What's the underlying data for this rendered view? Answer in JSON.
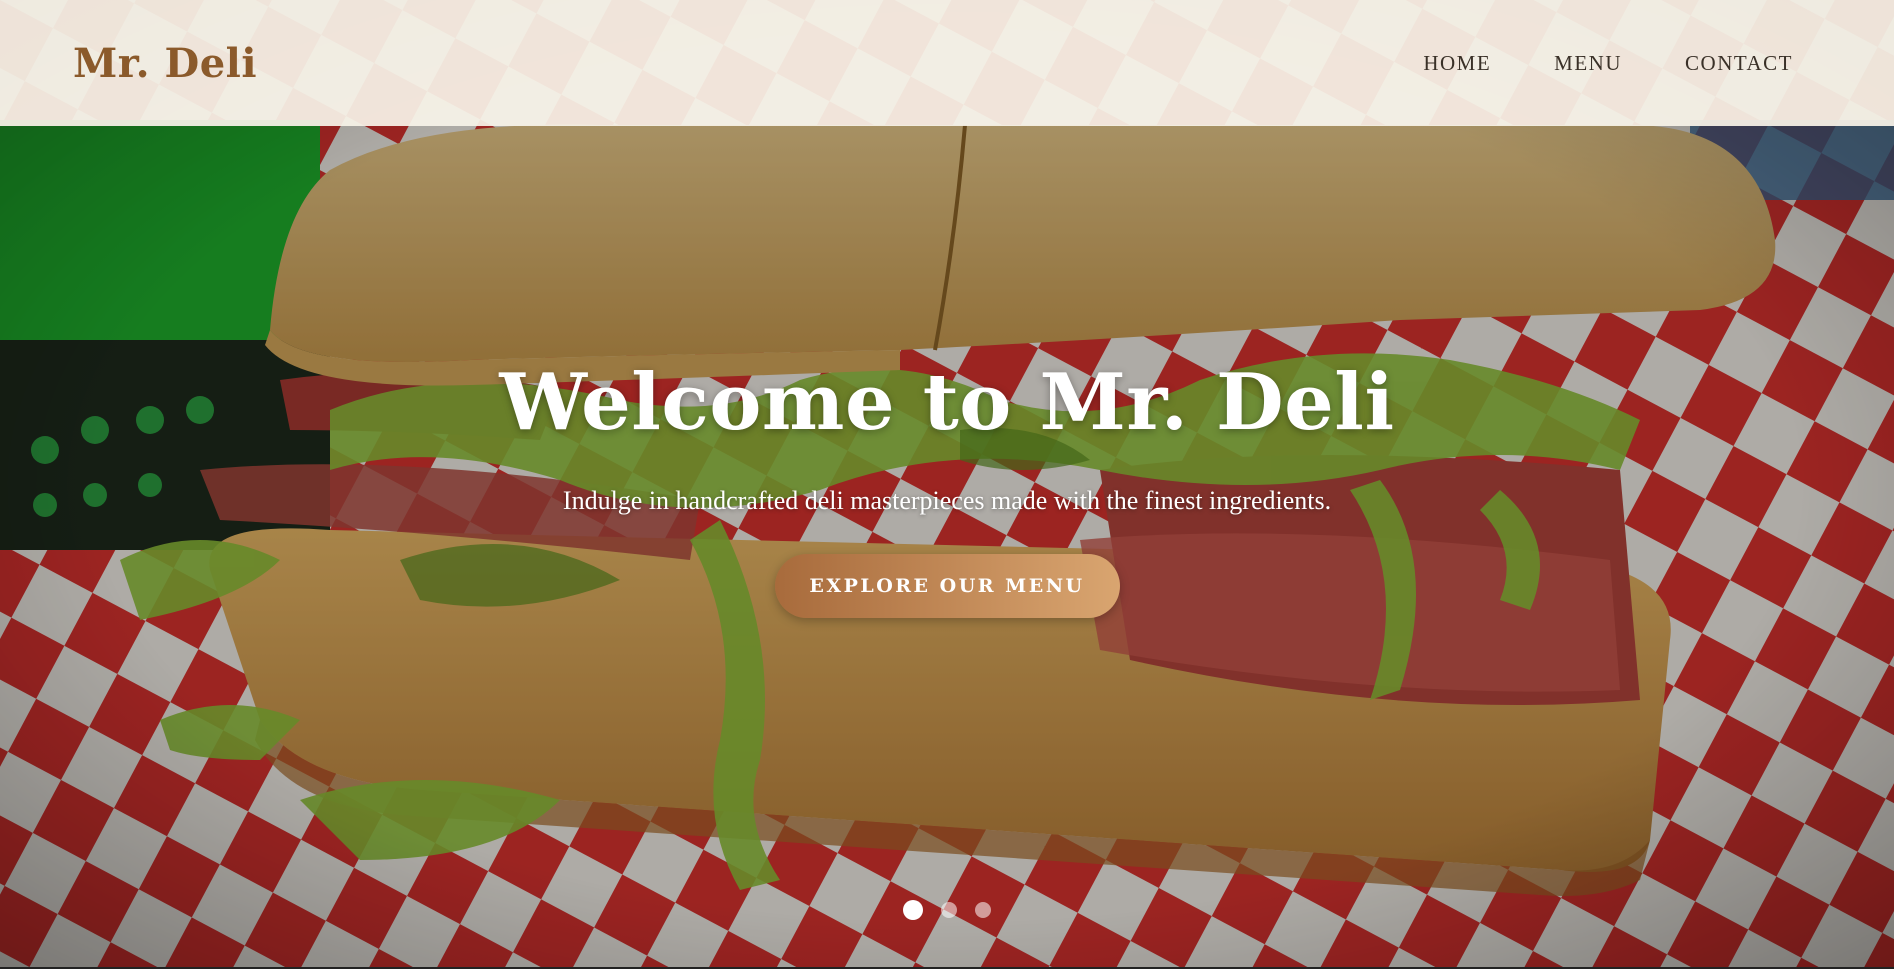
{
  "header": {
    "logo": "Mr. Deli",
    "nav": [
      "HOME",
      "MENU",
      "CONTACT"
    ]
  },
  "hero": {
    "title": "Welcome to Mr. Deli",
    "subtitle": "Indulge in handcrafted deli masterpieces made with the finest ingredients.",
    "cta_label": "EXPLORE OUR MENU",
    "background_image": "sandwich-photo",
    "slides_total": 3,
    "active_slide": 1
  },
  "colors": {
    "brand": "#8b5a2b",
    "cta_start": "#a86b3c",
    "cta_end": "#d9a570",
    "header_bg": "#f7f3e8"
  }
}
